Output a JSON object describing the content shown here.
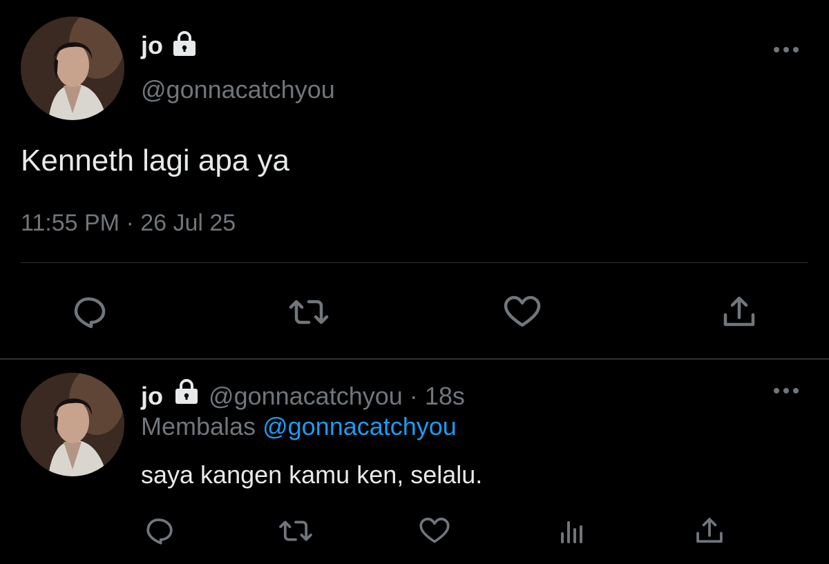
{
  "colors": {
    "background": "#000000",
    "text_primary": "#e7e9ea",
    "text_secondary": "#71767b",
    "link": "#1d9bf0",
    "divider": "#2f3336"
  },
  "main_tweet": {
    "display_name": "jo",
    "handle": "@gonnacatchyou",
    "text": "Kenneth lagi apa ya",
    "timestamp": "11:55 PM · 26 Jul 25",
    "icons": {
      "lock": "lock-icon",
      "more": "more-icon",
      "reply": "reply-icon",
      "retweet": "retweet-icon",
      "like": "like-icon",
      "share": "share-icon"
    }
  },
  "reply_tweet": {
    "display_name": "jo",
    "handle": "@gonnacatchyou",
    "separator": "·",
    "time_ago": "18s",
    "replying_label": "Membalas",
    "replying_to": "@gonnacatchyou",
    "text": "saya kangen kamu ken, selalu.",
    "icons": {
      "lock": "lock-icon",
      "more": "more-icon",
      "reply": "reply-icon",
      "retweet": "retweet-icon",
      "like": "like-icon",
      "analytics": "analytics-icon",
      "share": "share-icon"
    }
  }
}
